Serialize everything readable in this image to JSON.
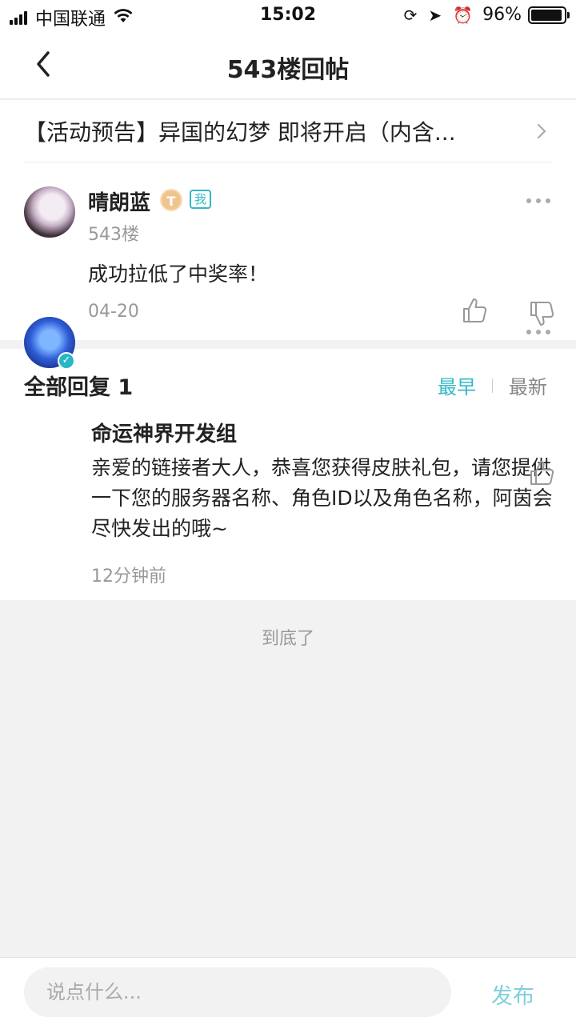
{
  "status_bar": {
    "carrier": "中国联通",
    "time": "15:02",
    "battery": "96%"
  },
  "nav": {
    "title": "543楼回帖"
  },
  "thread": {
    "title": "【活动预告】异国的幻梦 即将开启（内含..."
  },
  "post": {
    "username": "晴朗蓝",
    "level_badge": "T",
    "me_badge": "我",
    "floor": "543楼",
    "content": "成功拉低了中奖率！",
    "date": "04-20"
  },
  "replies": {
    "header": "全部回复 1",
    "sort_options": [
      "最早",
      "最新"
    ],
    "items": [
      {
        "username": "命运神界开发组",
        "text": "亲爱的链接者大人，恭喜您获得皮肤礼包，请您提供一下您的服务器名称、角色ID以及角色名称，阿茵会尽快发出的哦~",
        "time": "12分钟前"
      }
    ]
  },
  "end_text": "到底了",
  "composer": {
    "placeholder": "说点什么...",
    "publish_label": "发布"
  },
  "colors": {
    "accent": "#33b8c6",
    "publish_disabled": "#7fd0da"
  }
}
